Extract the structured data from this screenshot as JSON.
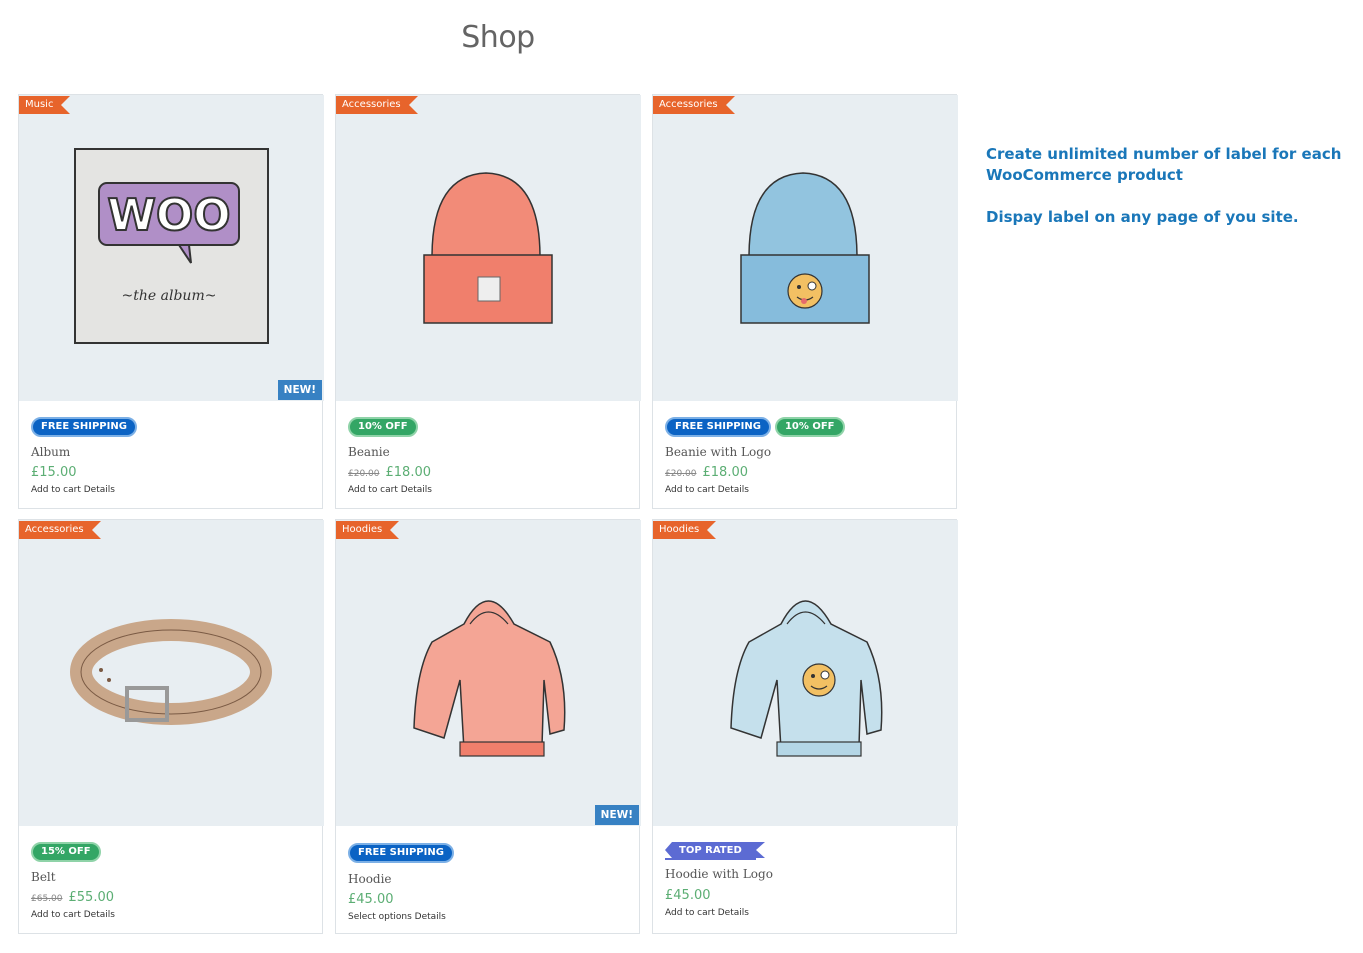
{
  "page": {
    "title": "Shop"
  },
  "sidebar": {
    "line1": "Create unlimited number of label for each WooCommerce product",
    "line2": "Dispay label on any page of you site."
  },
  "products": [
    {
      "category": "Music",
      "corner_badge": "NEW!",
      "badges": [
        "FREE SHIPPING"
      ],
      "name": "Album",
      "old_price": "",
      "price": "£15.00",
      "actions": "Add to cart Details"
    },
    {
      "category": "Accessories",
      "corner_badge": "",
      "badges": [
        "10% OFF"
      ],
      "name": "Beanie",
      "old_price": "£20.00",
      "price": "£18.00",
      "actions": "Add to cart Details"
    },
    {
      "category": "Accessories",
      "corner_badge": "",
      "badges": [
        "FREE SHIPPING",
        "10% OFF"
      ],
      "name": "Beanie with Logo",
      "old_price": "£20.00",
      "price": "£18.00",
      "actions": "Add to cart Details"
    },
    {
      "category": "Accessories",
      "corner_badge": "",
      "badges": [
        "15% OFF"
      ],
      "name": "Belt",
      "old_price": "£65.00",
      "price": "£55.00",
      "actions": "Add to cart Details"
    },
    {
      "category": "Hoodies",
      "corner_badge": "NEW!",
      "badges": [
        "FREE SHIPPING"
      ],
      "name": "Hoodie",
      "old_price": "",
      "price": "£45.00",
      "actions": "Select options Details"
    },
    {
      "category": "Hoodies",
      "corner_badge": "",
      "badges": [
        "TOP RATED"
      ],
      "name": "Hoodie with Logo",
      "old_price": "",
      "price": "£45.00",
      "actions": "Add to cart Details"
    }
  ],
  "colors": {
    "category": "#e7642b",
    "price": "#5cae74",
    "free_shipping": "#0b63c4",
    "discount": "#33a665",
    "top_rated": "#5c6bd3",
    "new": "#3781c3",
    "note": "#1a77b9"
  }
}
